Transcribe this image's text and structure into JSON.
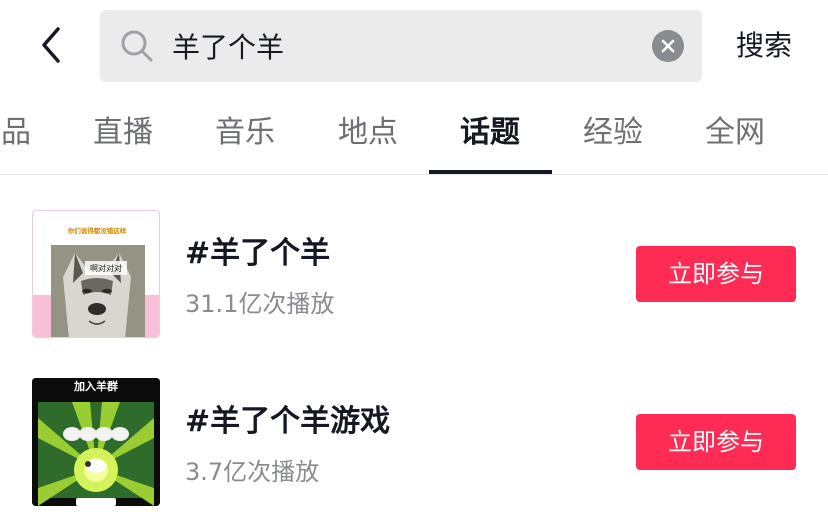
{
  "search": {
    "query": "羊了个羊",
    "submit_label": "搜索"
  },
  "tabs": [
    {
      "label": "品"
    },
    {
      "label": "直播"
    },
    {
      "label": "音乐"
    },
    {
      "label": "地点"
    },
    {
      "label": "话题",
      "active": true
    },
    {
      "label": "经验"
    },
    {
      "label": "全网"
    }
  ],
  "topics": [
    {
      "title": "#羊了个羊",
      "plays": "31.1亿次播放",
      "button_label": "立即参与",
      "thumb_caption": "你们说得都没错这样",
      "thumb_bubble": "啊对对对"
    },
    {
      "title": "#羊了个羊游戏",
      "plays": "3.7亿次播放",
      "button_label": "立即参与",
      "thumb_caption": "加入羊群"
    }
  ],
  "colors": {
    "accent": "#fe2c55",
    "tab_active": "#161823",
    "tab_inactive": "#6e6f74",
    "search_bg": "#ebebeb"
  },
  "icons": {
    "back": "chevron-left-icon",
    "search": "search-icon",
    "clear": "clear-icon"
  }
}
